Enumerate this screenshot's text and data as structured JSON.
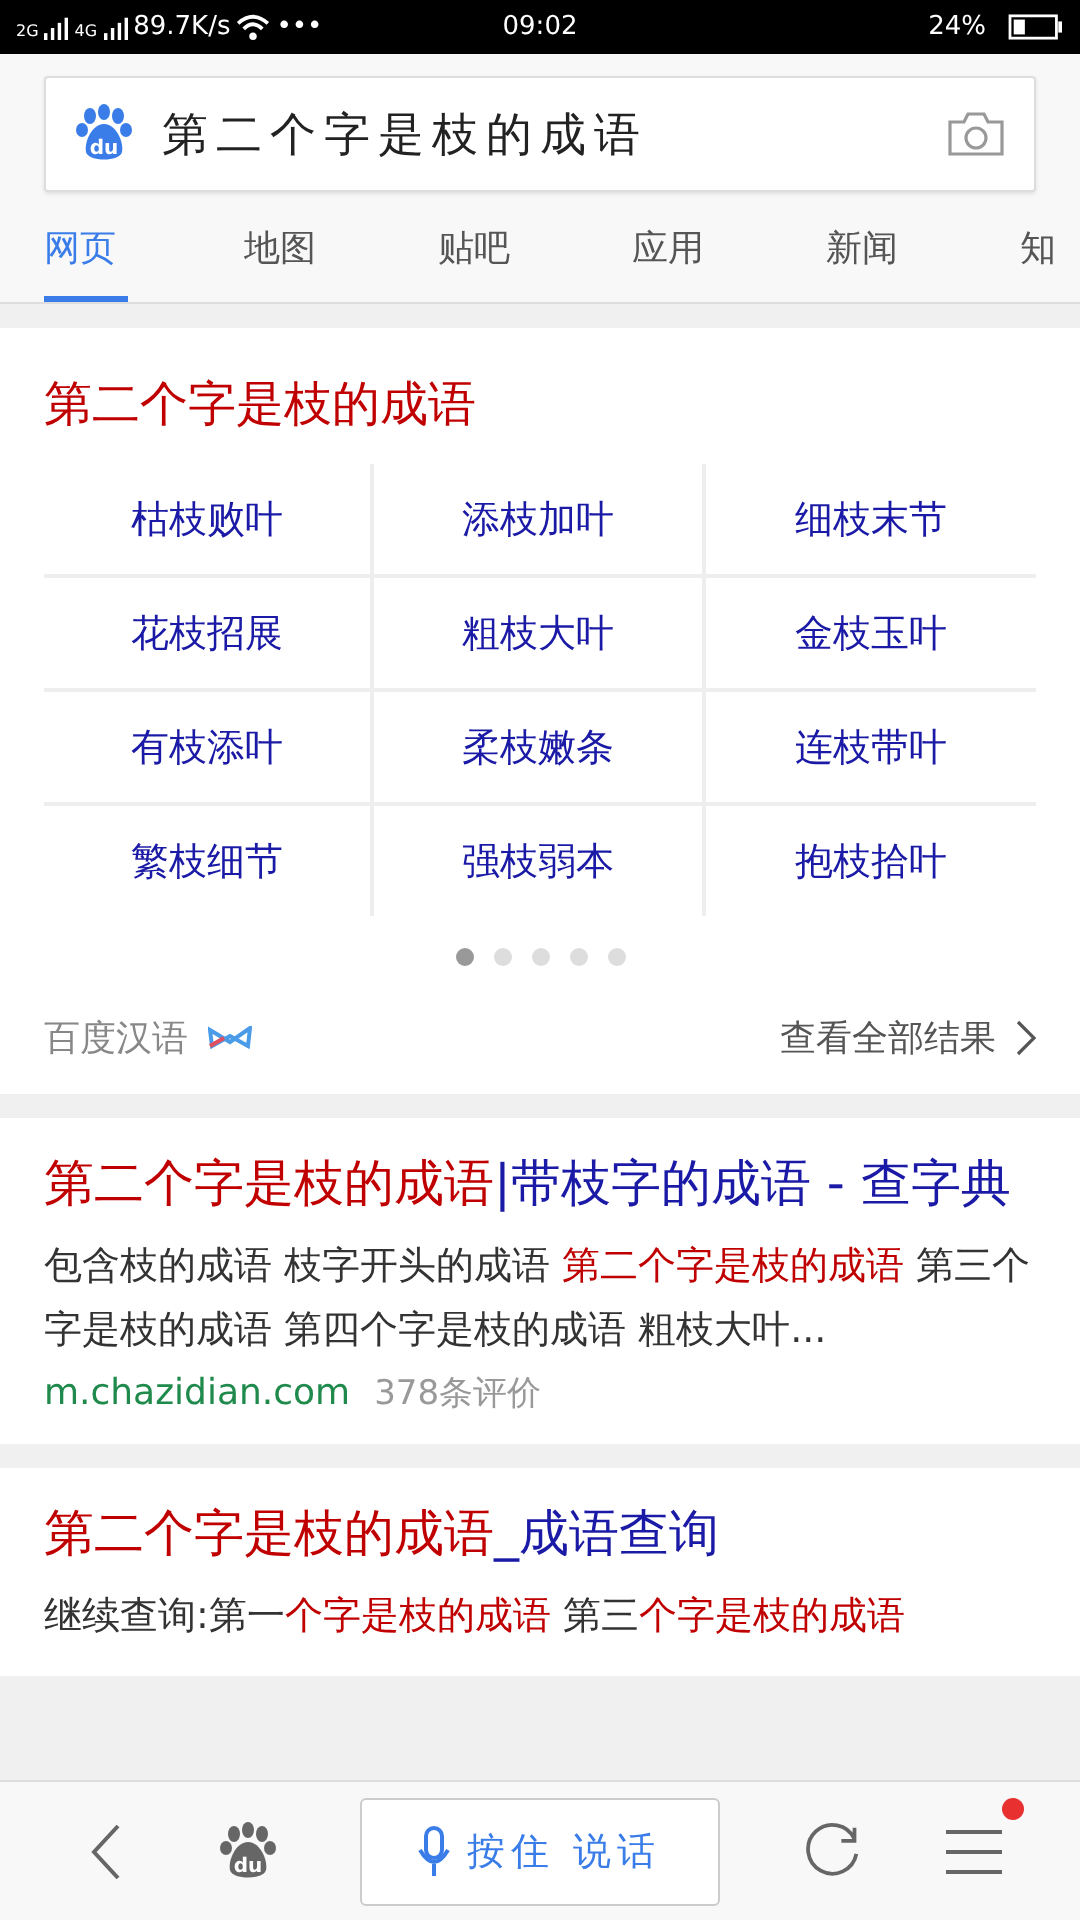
{
  "status_bar": {
    "signal_1": "2G",
    "signal_2": "4G",
    "speed": "89.7K/s",
    "more": "•••",
    "time": "09:02",
    "battery_text": "24%"
  },
  "search": {
    "logo_text": "du",
    "value": "第二个字是枝的成语"
  },
  "tabs": [
    {
      "label": "网页",
      "selected": true
    },
    {
      "label": "地图",
      "selected": false
    },
    {
      "label": "贴吧",
      "selected": false
    },
    {
      "label": "应用",
      "selected": false
    },
    {
      "label": "新闻",
      "selected": false
    },
    {
      "label": "知",
      "selected": false
    }
  ],
  "idiom_card": {
    "title": "第二个字是枝的成语",
    "idioms": [
      "枯枝败叶",
      "添枝加叶",
      "细枝末节",
      "花枝招展",
      "粗枝大叶",
      "金枝玉叶",
      "有枝添叶",
      "柔枝嫩条",
      "连枝带叶",
      "繁枝细节",
      "强枝弱本",
      "抱枝拾叶"
    ],
    "pages": [
      {
        "selected": true
      },
      {
        "selected": false
      },
      {
        "selected": false
      },
      {
        "selected": false
      },
      {
        "selected": false
      }
    ],
    "source": "百度汉语",
    "more_link": "查看全部结果"
  },
  "results": [
    {
      "title": [
        {
          "text": "第二个字是枝的成语",
          "highlight": true
        },
        {
          "text": "|带枝字的成语 - 查字典",
          "highlight": false
        }
      ],
      "snippet": [
        {
          "text": "包含枝的成语 枝字开头的成语 ",
          "highlight": false
        },
        {
          "text": "第二个字是枝的成语",
          "highlight": true
        },
        {
          "text": " 第三个字是枝的成语 第四个字是枝的成语 粗枝大叶...",
          "highlight": false
        }
      ],
      "site": "m.chazidian.com",
      "reviews": "378条评价"
    },
    {
      "title": [
        {
          "text": "第二个字是枝的成语",
          "highlight": true
        },
        {
          "text": "_成语查询",
          "highlight": false
        }
      ],
      "snippet": [
        {
          "text": "继续查询:第一",
          "highlight": false
        },
        {
          "text": "个字是枝的成语",
          "highlight": true
        },
        {
          "text": " 第三",
          "highlight": false
        },
        {
          "text": "个字是枝的成语",
          "highlight": true
        }
      ]
    }
  ],
  "bottom_bar": {
    "logo_text": "du",
    "voice_label": "按住 说话",
    "menu_badge": true
  }
}
